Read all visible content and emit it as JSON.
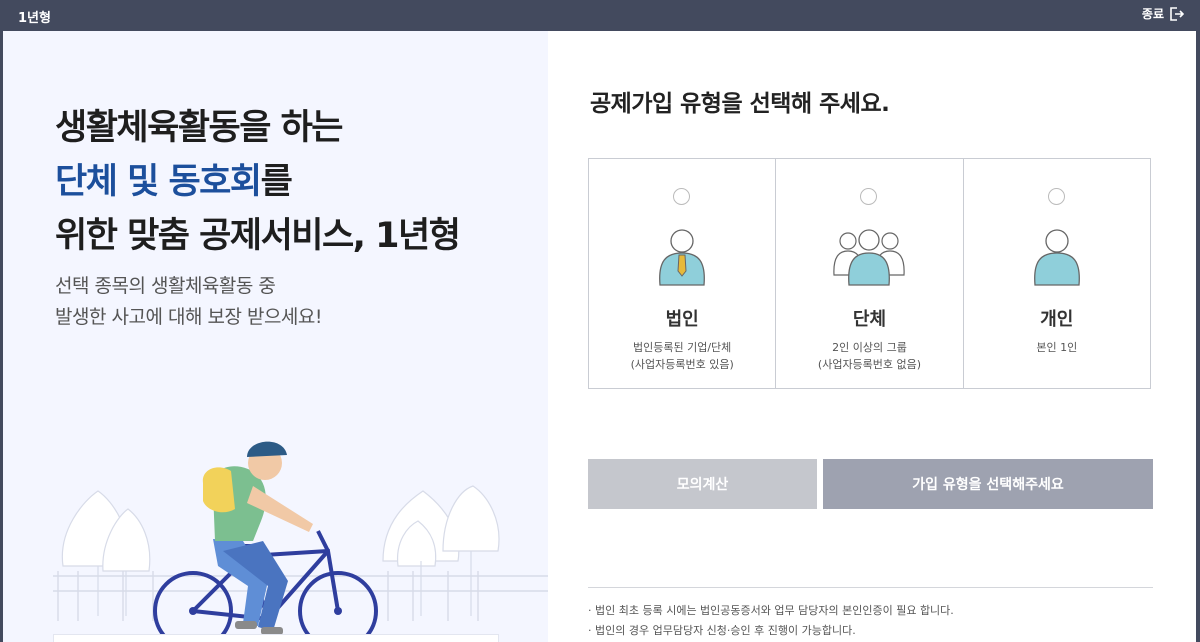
{
  "window": {
    "title": "1년형",
    "close_label": "종료"
  },
  "hero": {
    "line1": "생활체육활동을 하는",
    "line2_accent": "단체 및 동호회",
    "line2_rest": "를",
    "line3": "위한 맞춤 공제서비스, 1년형",
    "sub1": "선택 종목의 생활체육활동 중",
    "sub2": "발생한 사고에 대해 보장 받으세요!"
  },
  "panel": {
    "title": "공제가입 유형을 선택해 주세요.",
    "cards": [
      {
        "label": "법인",
        "desc1": "법인등록된 기업/단체",
        "desc2": "(사업자등록번호 있음)",
        "icon": "businessperson-icon"
      },
      {
        "label": "단체",
        "desc1": "2인 이상의 그룹",
        "desc2": "(사업자등록번호 없음)",
        "icon": "group-icon"
      },
      {
        "label": "개인",
        "desc1": "본인 1인",
        "desc2": "",
        "icon": "person-icon"
      }
    ],
    "buttons": {
      "calc": "모의계산",
      "select": "가입 유형을 선택해주세요"
    },
    "notes": [
      "· 법인 최초 등록 시에는 법인공동증서와 업무 담당자의 본인인증이 필요 합니다.",
      "· 법인의 경우 업무담당자 신청·승인 후 진행이 가능합니다."
    ]
  },
  "colors": {
    "titlebar": "#434a5e",
    "accent": "#1c4f9c",
    "left_bg": "#f4f6ff",
    "icon_teal": "#8fcfda",
    "tie": "#e6b93a"
  }
}
